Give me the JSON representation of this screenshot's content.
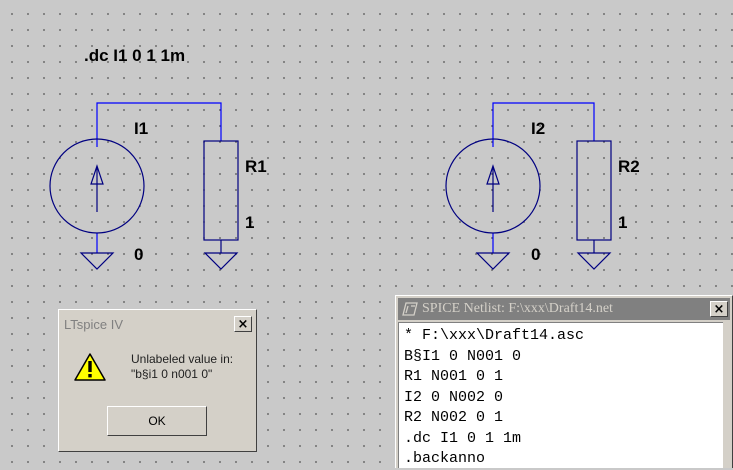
{
  "schematic": {
    "directive": ".dc I1 0 1 1m",
    "components": [
      {
        "ref": "I1",
        "kind": "current-source",
        "value": "0"
      },
      {
        "ref": "R1",
        "kind": "resistor",
        "value": "1"
      },
      {
        "ref": "I2",
        "kind": "current-source",
        "value": "0"
      },
      {
        "ref": "R2",
        "kind": "resistor",
        "value": "1"
      }
    ],
    "wire_color": "#0000ff",
    "symbol_color": "#000080"
  },
  "netlist_window": {
    "title": "SPICE Netlist: F:\\xxx\\Draft14.net",
    "close_label": "×",
    "lines": [
      "* F:\\xxx\\Draft14.asc",
      "B§I1 0 N001 0",
      "R1 N001 0 1",
      "I2 0 N002 0",
      "R2 N002 0 1",
      ".dc I1 0 1 1m",
      ".backanno"
    ],
    "icon": "ltspice-logo-icon"
  },
  "message_box": {
    "title": "LTspice IV",
    "close_label": "×",
    "message_line1": "Unlabeled value in:",
    "message_line2": "\"b§i1 0 n001 0\"",
    "ok_label": "OK",
    "icon": "warning-icon"
  }
}
